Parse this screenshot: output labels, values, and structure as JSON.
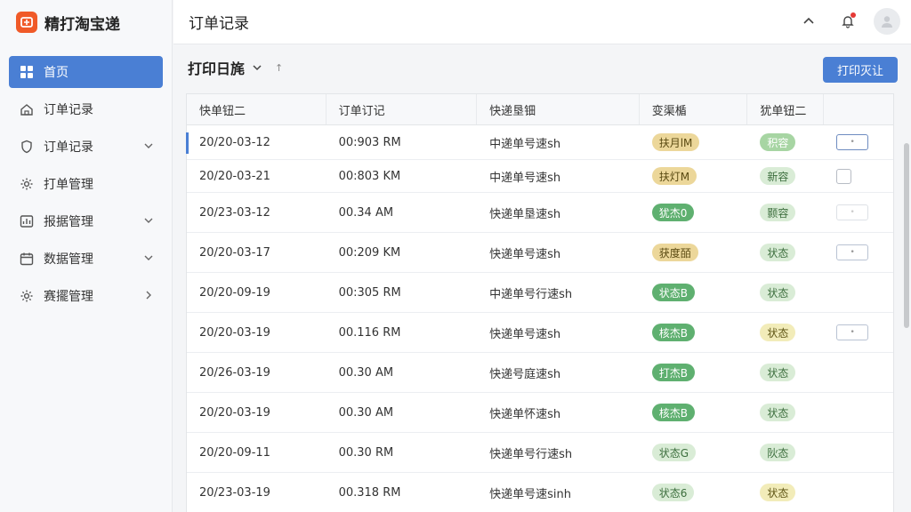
{
  "app": {
    "name": "精打淘宝递"
  },
  "sidebar": {
    "items": [
      {
        "label": "首页",
        "icon": "grid-icon",
        "active": true,
        "chevron": ""
      },
      {
        "label": "订单记录",
        "icon": "home-icon",
        "active": false,
        "chevron": ""
      },
      {
        "label": "订单记录",
        "icon": "shield-icon",
        "active": false,
        "chevron": "down"
      },
      {
        "label": "打单管理",
        "icon": "gear-icon",
        "active": false,
        "chevron": ""
      },
      {
        "label": "报据管理",
        "icon": "chart-icon",
        "active": false,
        "chevron": "down"
      },
      {
        "label": "数据管理",
        "icon": "calendar-icon",
        "active": false,
        "chevron": "down"
      },
      {
        "label": "赛擺管理",
        "icon": "gear-icon",
        "active": false,
        "chevron": "right"
      }
    ]
  },
  "header": {
    "title": "订单记录"
  },
  "toolbar": {
    "filter_label": "打印日旄",
    "sort_mark": "↑",
    "print_label": "打印灭让"
  },
  "table": {
    "columns": [
      "快单钮二",
      "订单订记",
      "快递垦钿",
      "变渠楯",
      "犹单钮二"
    ],
    "rows": [
      {
        "date": "20/20-03-12",
        "time": "00:903 RM",
        "desc": "中递单号速sh",
        "s1": "扶月lM",
        "s1c": "p-yellow",
        "s2": "积容",
        "s2c": "p-mgreen",
        "action": "btn-strong",
        "selected": true
      },
      {
        "date": "20/20-03-21",
        "time": "00:803 KM",
        "desc": "中递单号速sh",
        "s1": "扶灯M",
        "s1c": "p-yellow",
        "s2": "新容",
        "s2c": "p-lgreen",
        "action": "checkbox",
        "selected": false
      },
      {
        "date": "20/23-03-12",
        "time": "00.34 AM",
        "desc": "快递单垦速sh",
        "s1": "犹杰0",
        "s1c": "p-green",
        "s2": "颢容",
        "s2c": "p-lgreen",
        "action": "btn-faint",
        "selected": false
      },
      {
        "date": "20/20-03-17",
        "time": "00:209 KM",
        "desc": "快递单号速sh",
        "s1": "获度皕",
        "s1c": "p-yellow",
        "s2": "状态",
        "s2c": "p-lgreen",
        "action": "btn",
        "selected": false
      },
      {
        "date": "20/20-09-19",
        "time": "00:305 RM",
        "desc": "中递单号行速sh",
        "s1": "状态B",
        "s1c": "p-green",
        "s2": "状态",
        "s2c": "p-lgreen",
        "action": "",
        "selected": false
      },
      {
        "date": "20/20-03-19",
        "time": "00.116 RM",
        "desc": "快递单号速sh",
        "s1": "核杰B",
        "s1c": "p-green",
        "s2": "状态",
        "s2c": "p-cream",
        "action": "btn",
        "selected": false
      },
      {
        "date": "20/26-03-19",
        "time": "00.30 AM",
        "desc": "快递号庭速sh",
        "s1": "打杰B",
        "s1c": "p-green",
        "s2": "状态",
        "s2c": "p-lgreen",
        "action": "",
        "selected": false
      },
      {
        "date": "20/20-03-19",
        "time": "00.30 AM",
        "desc": "快递单怀速sh",
        "s1": "核杰B",
        "s1c": "p-green",
        "s2": "状态",
        "s2c": "p-lgreen",
        "action": "",
        "selected": false
      },
      {
        "date": "20/20-09-11",
        "time": "00.30 RM",
        "desc": "快递单号行速sh",
        "s1": "状态G",
        "s1c": "p-lgreen",
        "s2": "阦态",
        "s2c": "p-lgreen",
        "action": "",
        "selected": false
      },
      {
        "date": "20/23-03-19",
        "time": "00.318 RM",
        "desc": "快递单号速sinh",
        "s1": "状态6",
        "s1c": "p-lgreen",
        "s2": "状态",
        "s2c": "p-cream",
        "action": "",
        "selected": false
      }
    ]
  },
  "colors": {
    "accent": "#4a7fd4",
    "brand": "#f05a28"
  }
}
